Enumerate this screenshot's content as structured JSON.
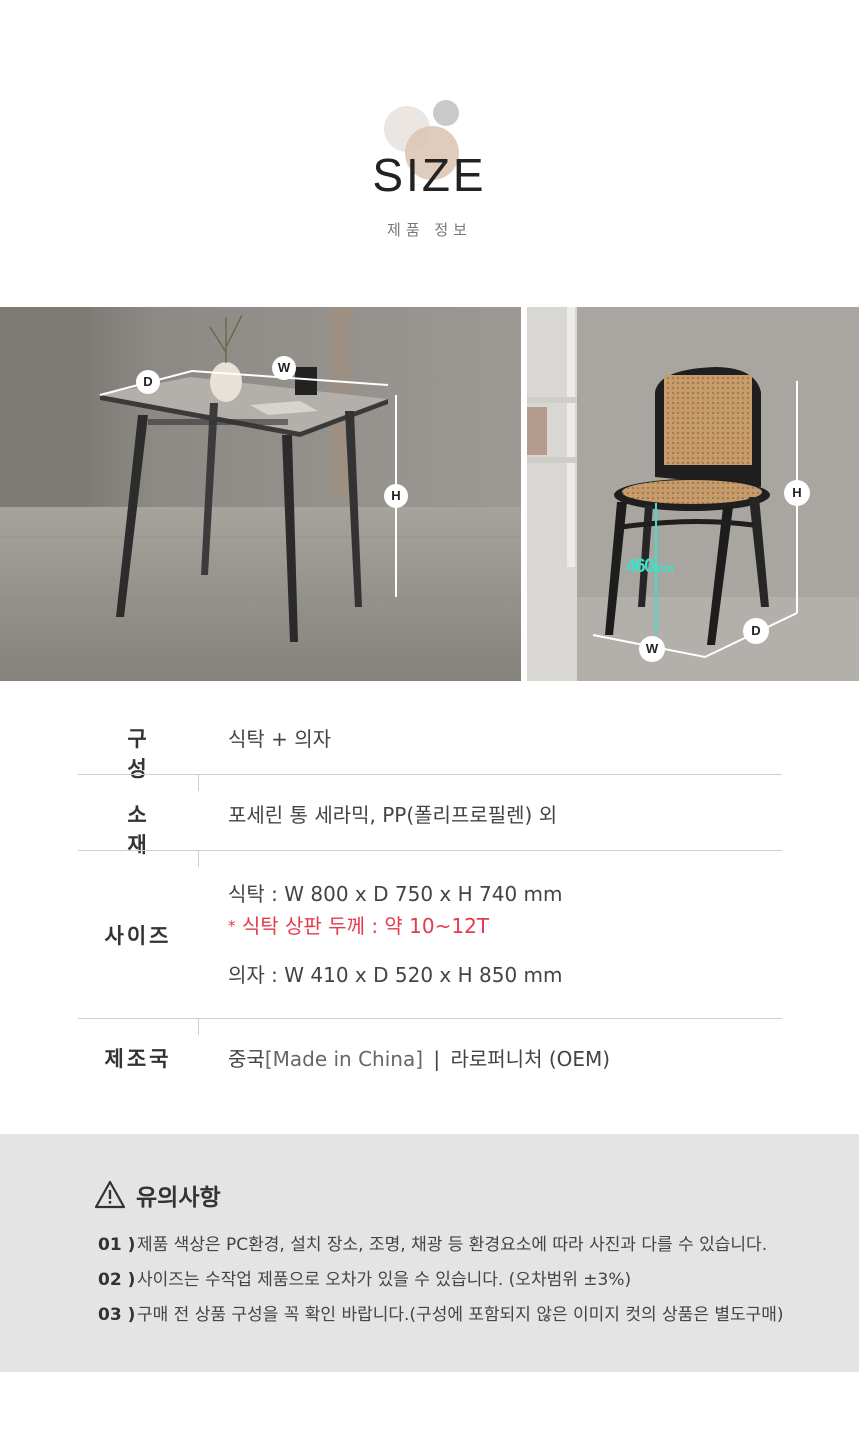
{
  "header": {
    "title": "SIZE",
    "subtitle": "제품 정보"
  },
  "photos": {
    "table": {
      "label_d": "D",
      "label_w": "W",
      "label_h": "H"
    },
    "chair": {
      "label_h": "H",
      "label_w": "W",
      "label_d": "D",
      "seat_height": "460",
      "seat_unit": "mm"
    }
  },
  "spec": {
    "composition": {
      "label": "구  성",
      "value": "식탁 + 의자"
    },
    "material": {
      "label": "소  재",
      "value": "포세린 통 세라믹, PP(폴리프로필렌) 외"
    },
    "size": {
      "label": "사이즈",
      "table": "식탁 : W 800 x D 750 x H 740 mm",
      "table_note_mark": "*",
      "table_note": "식탁 상판 두께 : 약 10~12T",
      "chair": "의자 : W 410 x D 520 x H 850 mm"
    },
    "origin": {
      "label": "제조국",
      "country": "중국",
      "country_en": "[Made in China]",
      "separator": "|",
      "maker": "라로퍼니처 (OEM)"
    }
  },
  "notice": {
    "title": "유의사항",
    "items": [
      {
        "num": "01 )",
        "text": "제품 색상은 PC환경, 설치 장소, 조명, 채광 등 환경요소에 따라 사진과 다를 수 있습니다."
      },
      {
        "num": "02 )",
        "text": "사이즈는 수작업 제품으로 오차가 있을 수 있습니다. (오차범위 ±3%)"
      },
      {
        "num": "03 )",
        "text": "구매 전 상품 구성을 꼭 확인 바랍니다.(구성에 포함되지 않은 이미지 컷의 상품은 별도구매)"
      }
    ]
  },
  "colors": {
    "accent_red": "#e43b4d",
    "seat_height_line": "#3fe0c8",
    "notice_bg": "#e4e4e4"
  }
}
